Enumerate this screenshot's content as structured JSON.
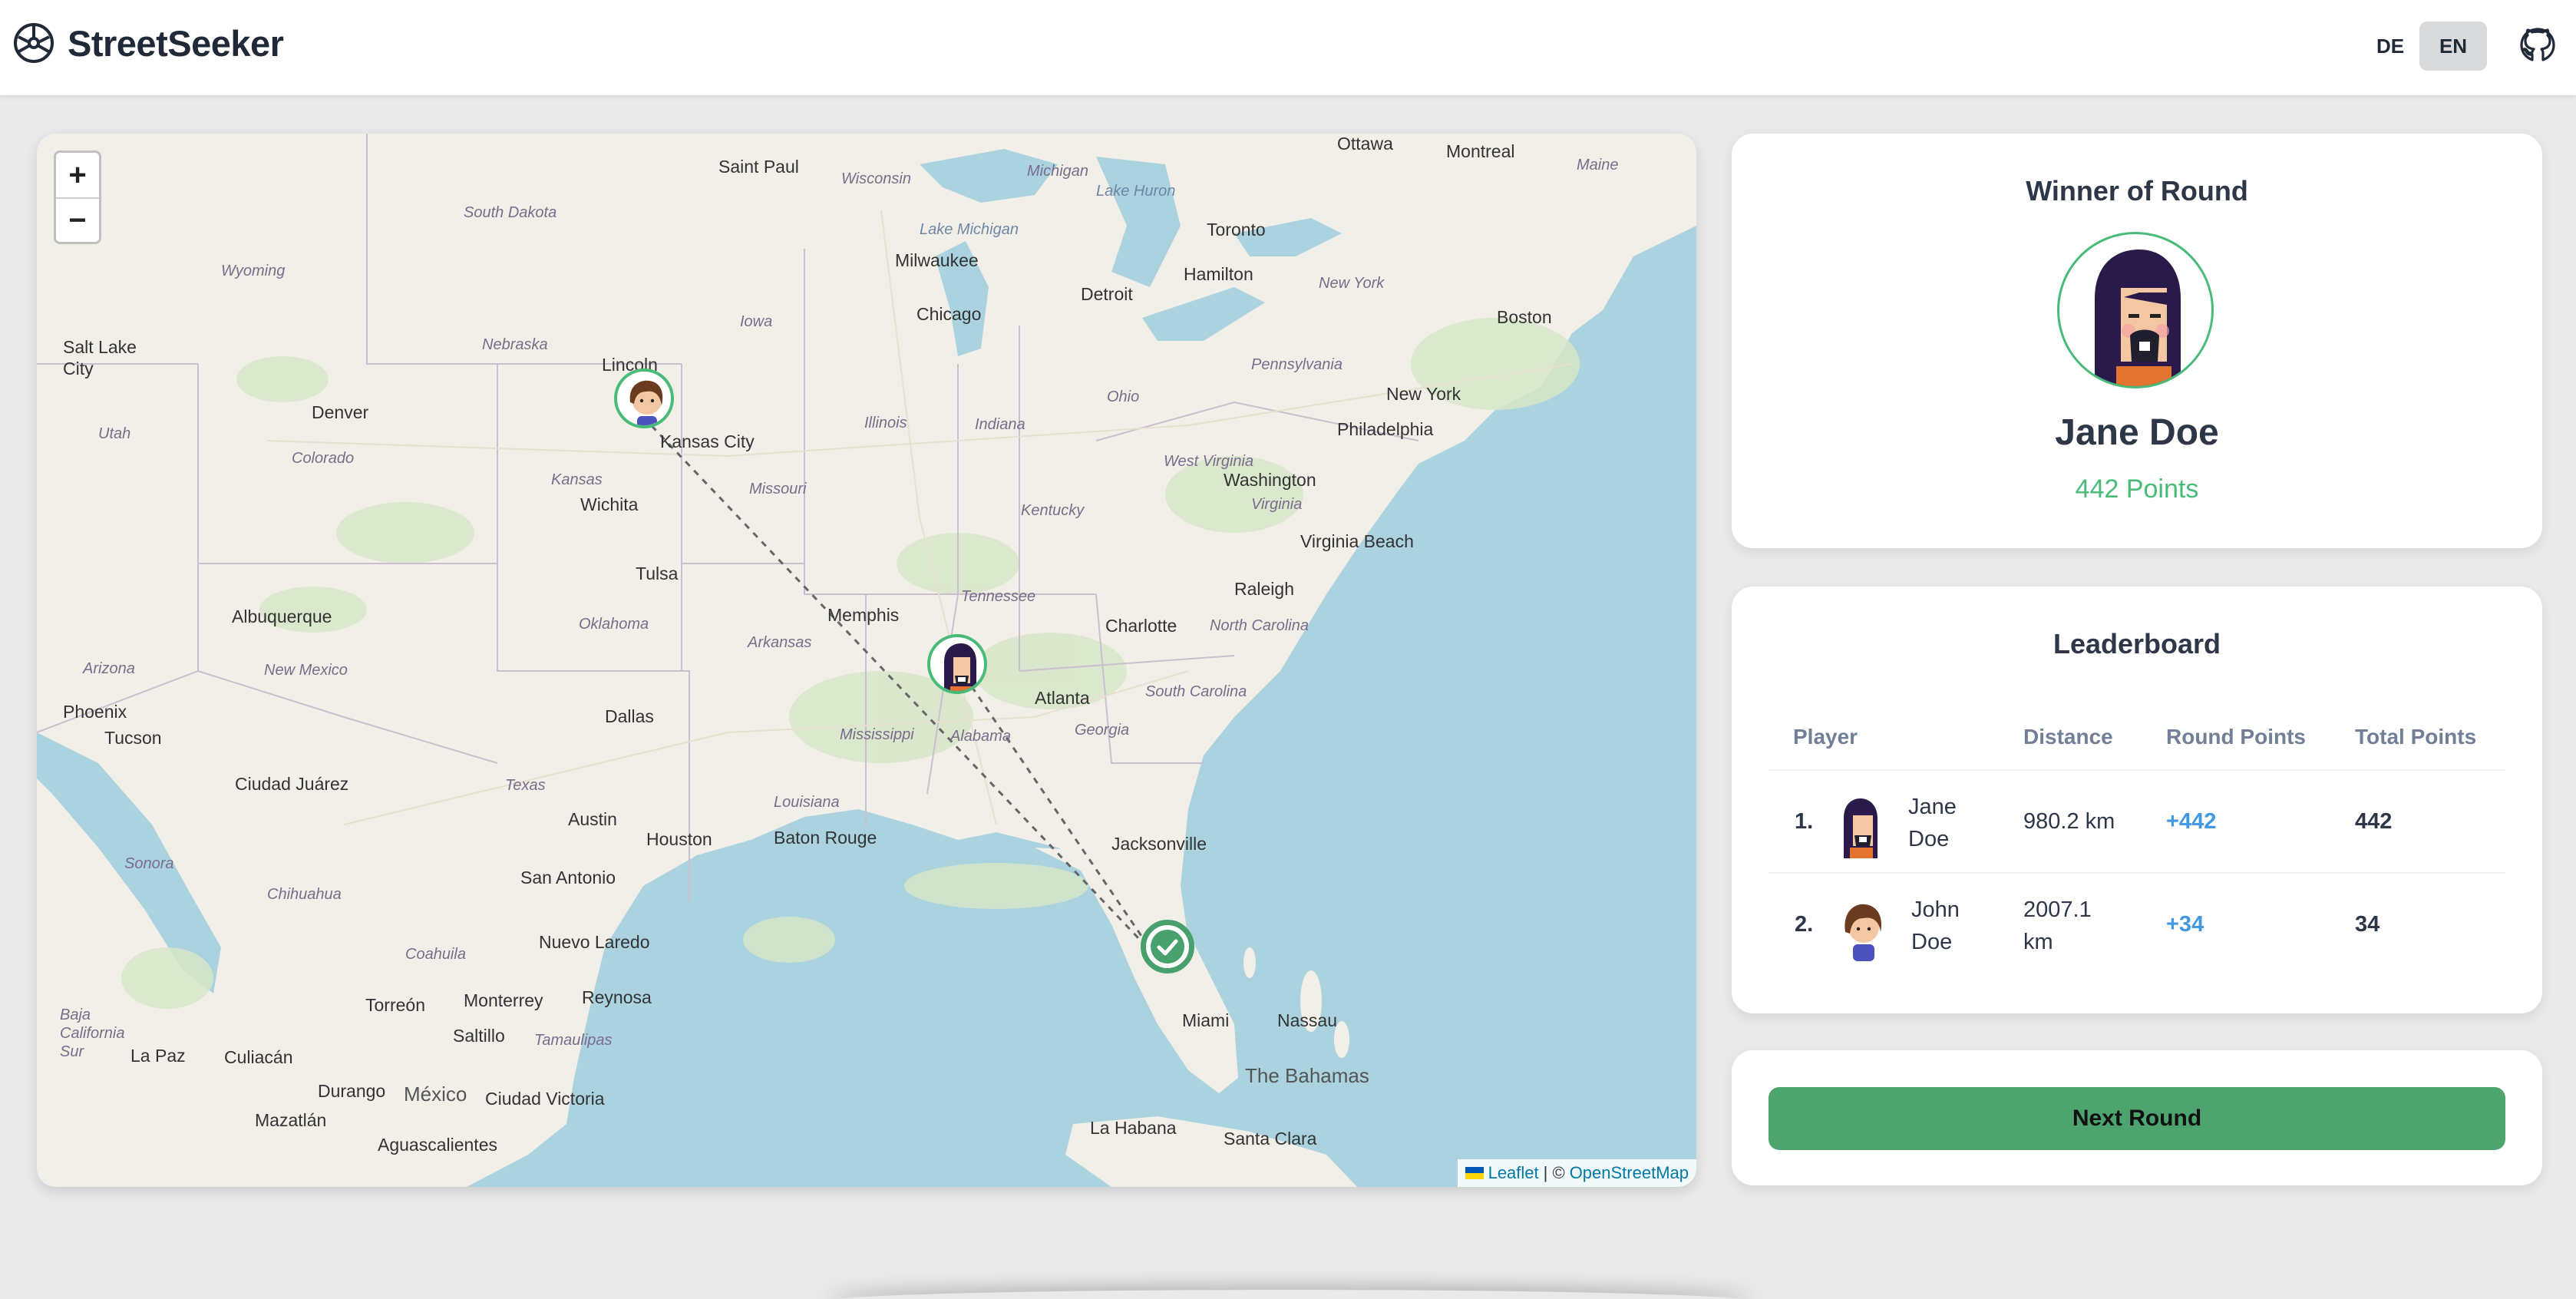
{
  "app": {
    "name": "StreetSeeker",
    "languages": [
      {
        "code": "DE",
        "active": false
      },
      {
        "code": "EN",
        "active": true
      }
    ],
    "github_icon": "github-icon"
  },
  "map": {
    "zoom_in": "+",
    "zoom_out": "−",
    "attribution": {
      "leaflet": "Leaflet",
      "separator": "| ©",
      "osm": "OpenStreetMap"
    },
    "labels": {
      "cities": [
        "Saint Paul",
        "Ottawa",
        "Montreal",
        "Milwaukee",
        "Toronto",
        "Hamilton",
        "Detroit",
        "Chicago",
        "Boston",
        "New York",
        "Philadelphia",
        "Washington",
        "Virginia Beach",
        "Raleigh",
        "Charlotte",
        "Atlanta",
        "Jacksonville",
        "Miami",
        "Nassau",
        "Memphis",
        "Tulsa",
        "Dallas",
        "Austin",
        "Houston",
        "San Antonio",
        "Baton Rouge",
        "Lincoln",
        "Kansas City",
        "Wichita",
        "Denver",
        "Salt Lake City",
        "Albuquerque",
        "Phoenix",
        "Tucson",
        "Ciudad Juárez",
        "Nuevo Laredo",
        "Monterrey",
        "Reynosa",
        "Saltillo",
        "Torreón",
        "Durango",
        "La Paz",
        "Culiacán",
        "Mazatlán",
        "Aguascalientes",
        "Ciudad Victoria",
        "México",
        "La Habana",
        "Santa Clara"
      ],
      "regions": [
        "South Dakota",
        "Wyoming",
        "Nebraska",
        "Iowa",
        "Wisconsin",
        "Michigan",
        "Lake Michigan",
        "Lake Huron",
        "Maine",
        "New York",
        "Pennsylvania",
        "Ohio",
        "Illinois",
        "Indiana",
        "Missouri",
        "Kansas",
        "Colorado",
        "Utah",
        "West Virginia",
        "Virginia",
        "Kentucky",
        "Tennessee",
        "North Carolina",
        "South Carolina",
        "Oklahoma",
        "Arkansas",
        "Mississippi",
        "Alabama",
        "Georgia",
        "Louisiana",
        "Texas",
        "New Mexico",
        "Arizona",
        "Sonora",
        "Chihuahua",
        "Coahuila",
        "Baja California Sur",
        "Tamaulipas",
        "The Bahamas"
      ]
    },
    "markers": [
      {
        "player": "John Doe",
        "avatar": "john-doe-avatar"
      },
      {
        "player": "Jane Doe",
        "avatar": "jane-doe-avatar"
      }
    ],
    "target_icon": "check-target-icon"
  },
  "winner": {
    "title": "Winner of Round",
    "name": "Jane Doe",
    "points": "442 Points"
  },
  "leaderboard": {
    "title": "Leaderboard",
    "columns": [
      "Player",
      "Distance",
      "Round Points",
      "Total Points"
    ],
    "rows": [
      {
        "rank": "1.",
        "name_line1": "Jane",
        "name_line2": "Doe",
        "distance_line1": "980.2 km",
        "distance_line2": "",
        "round_points": "+442",
        "total_points": "442"
      },
      {
        "rank": "2.",
        "name_line1": "John",
        "name_line2": "Doe",
        "distance_line1": "2007.1",
        "distance_line2": "km",
        "round_points": "+34",
        "total_points": "34"
      }
    ]
  },
  "actions": {
    "next_round": "Next Round"
  },
  "colors": {
    "accent_green": "#48bb78",
    "button_green": "#4da46e",
    "link_blue": "#4299e1",
    "water": "#aad3df",
    "land": "#f2efe9"
  }
}
